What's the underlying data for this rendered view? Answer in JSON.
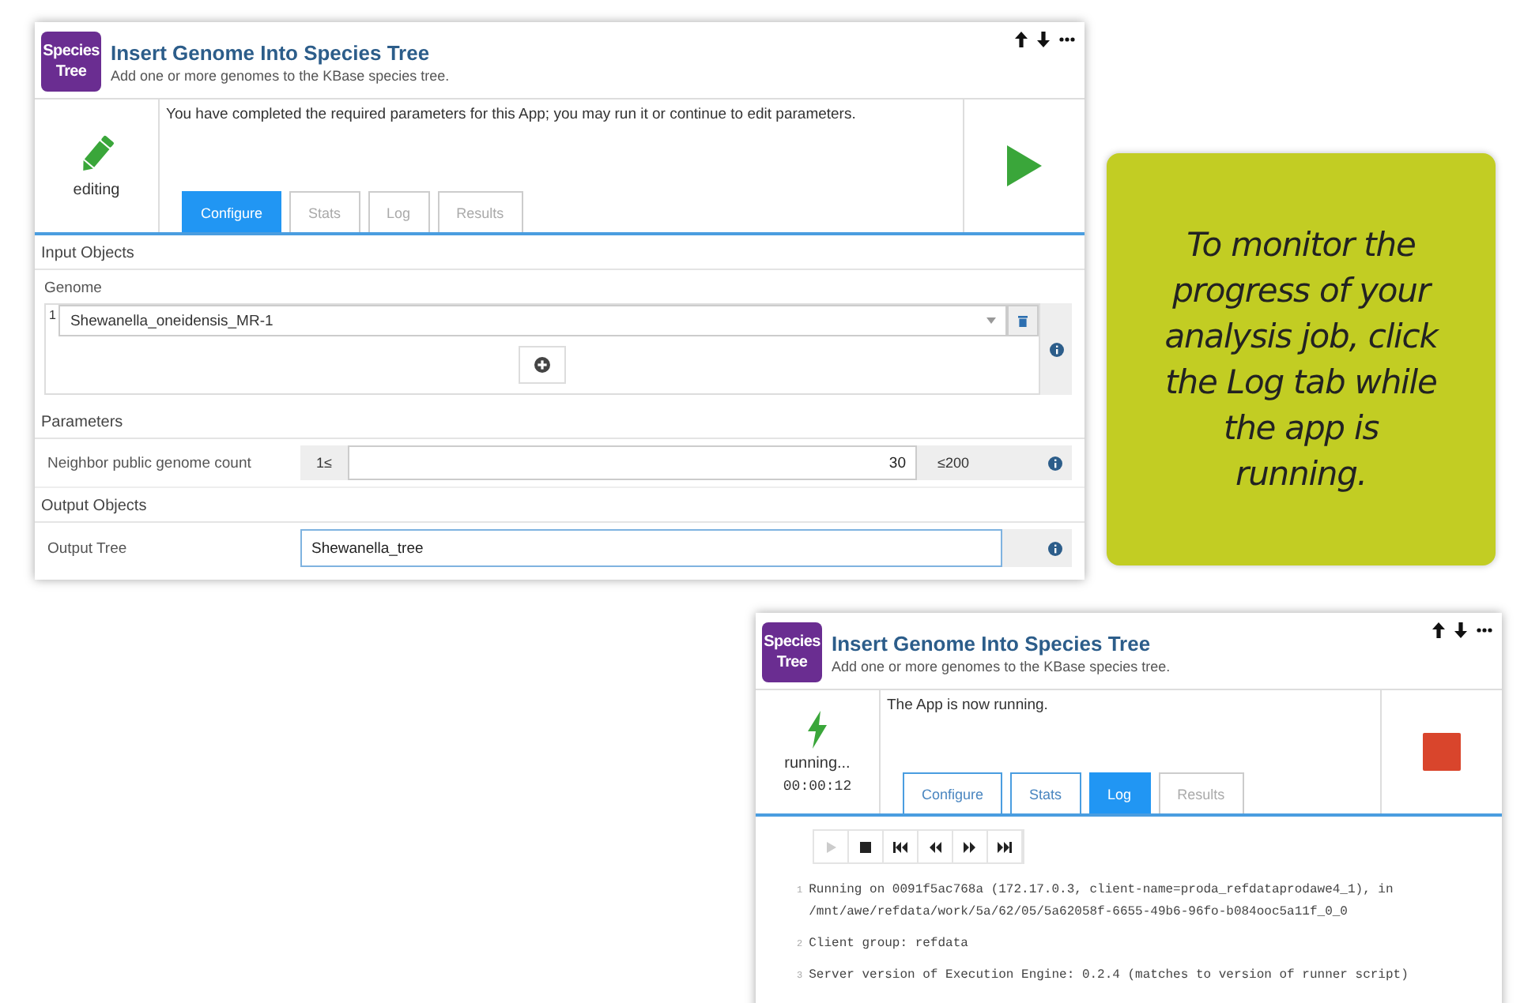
{
  "panels": [
    {
      "kind": "config",
      "logo": [
        "Species",
        "Tree"
      ],
      "title": "Insert Genome Into Species Tree",
      "subtitle": "Add one or more genomes to the KBase species tree.",
      "status": {
        "kind": "editing",
        "label": "editing"
      },
      "message": "You have completed the required parameters for this App; you may run it or continue to edit parameters.",
      "tabs": [
        {
          "label": "Configure",
          "selected": true,
          "disabled": false
        },
        {
          "label": "Stats",
          "selected": false,
          "disabled": true
        },
        {
          "label": "Log",
          "selected": false,
          "disabled": true
        },
        {
          "label": "Results",
          "selected": false,
          "disabled": true
        }
      ],
      "action": {
        "kind": "run"
      },
      "input_objects": {
        "title": "Input Objects",
        "label": "Genome",
        "rows": [
          {
            "index": "1",
            "value": "Shewanella_oneidensis_MR-1"
          }
        ]
      },
      "parameters": {
        "title": "Parameters",
        "label": "Neighbor public genome count",
        "min": "1≤",
        "value": "30",
        "max": "≤200"
      },
      "output_objects": {
        "title": "Output Objects",
        "label": "Output Tree",
        "value": "Shewanella_tree"
      }
    },
    {
      "kind": "log",
      "logo": [
        "Species",
        "Tree"
      ],
      "title": "Insert Genome Into Species Tree",
      "subtitle": "Add one or more genomes to the KBase species tree.",
      "status": {
        "kind": "running",
        "label": "running...",
        "timer": "00:00:12"
      },
      "message": "The App is now running.",
      "tabs": [
        {
          "label": "Configure",
          "selected": false,
          "disabled": false
        },
        {
          "label": "Stats",
          "selected": false,
          "disabled": false
        },
        {
          "label": "Log",
          "selected": true,
          "disabled": false
        },
        {
          "label": "Results",
          "selected": false,
          "disabled": true
        }
      ],
      "action": {
        "kind": "stop"
      },
      "log_controls": [
        {
          "kind": "play",
          "disabled": true
        },
        {
          "kind": "stop",
          "disabled": false
        },
        {
          "kind": "first",
          "disabled": false
        },
        {
          "kind": "prev",
          "disabled": false
        },
        {
          "kind": "next",
          "disabled": false
        },
        {
          "kind": "last",
          "disabled": false
        }
      ],
      "log_lines": [
        {
          "number": "1",
          "text": "Running on 0091f5ac768a (172.17.0.3, client-name=proda_refdataprodawe4_1), in /mnt/awe/refdata/work/5a/62/05/5a62058f-6655-49b6-96fo-b084ooc5a11f_0_0"
        },
        {
          "number": "2",
          "text": "Client group: refdata"
        },
        {
          "number": "3",
          "text": "Server version of Execution Engine: 0.2.4 (matches to version of runner script)"
        }
      ]
    }
  ],
  "callout": {
    "text": "To monitor the progress of your analysis job, click the Log tab while the app is running."
  }
}
